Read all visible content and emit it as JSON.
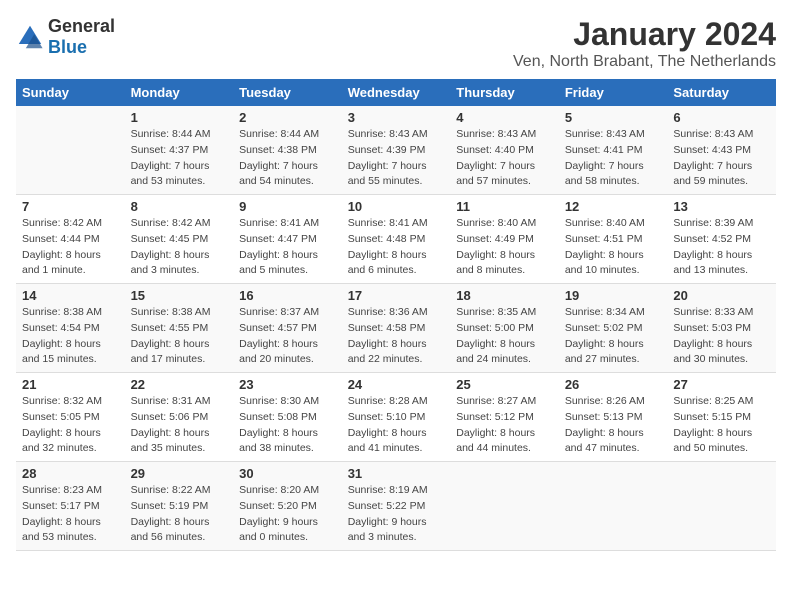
{
  "logo": {
    "text_general": "General",
    "text_blue": "Blue"
  },
  "header": {
    "title": "January 2024",
    "subtitle": "Ven, North Brabant, The Netherlands"
  },
  "calendar": {
    "weekdays": [
      "Sunday",
      "Monday",
      "Tuesday",
      "Wednesday",
      "Thursday",
      "Friday",
      "Saturday"
    ],
    "weeks": [
      [
        {
          "day": "",
          "sunrise": "",
          "sunset": "",
          "daylight": ""
        },
        {
          "day": "1",
          "sunrise": "Sunrise: 8:44 AM",
          "sunset": "Sunset: 4:37 PM",
          "daylight": "Daylight: 7 hours and 53 minutes."
        },
        {
          "day": "2",
          "sunrise": "Sunrise: 8:44 AM",
          "sunset": "Sunset: 4:38 PM",
          "daylight": "Daylight: 7 hours and 54 minutes."
        },
        {
          "day": "3",
          "sunrise": "Sunrise: 8:43 AM",
          "sunset": "Sunset: 4:39 PM",
          "daylight": "Daylight: 7 hours and 55 minutes."
        },
        {
          "day": "4",
          "sunrise": "Sunrise: 8:43 AM",
          "sunset": "Sunset: 4:40 PM",
          "daylight": "Daylight: 7 hours and 57 minutes."
        },
        {
          "day": "5",
          "sunrise": "Sunrise: 8:43 AM",
          "sunset": "Sunset: 4:41 PM",
          "daylight": "Daylight: 7 hours and 58 minutes."
        },
        {
          "day": "6",
          "sunrise": "Sunrise: 8:43 AM",
          "sunset": "Sunset: 4:43 PM",
          "daylight": "Daylight: 7 hours and 59 minutes."
        }
      ],
      [
        {
          "day": "7",
          "sunrise": "Sunrise: 8:42 AM",
          "sunset": "Sunset: 4:44 PM",
          "daylight": "Daylight: 8 hours and 1 minute."
        },
        {
          "day": "8",
          "sunrise": "Sunrise: 8:42 AM",
          "sunset": "Sunset: 4:45 PM",
          "daylight": "Daylight: 8 hours and 3 minutes."
        },
        {
          "day": "9",
          "sunrise": "Sunrise: 8:41 AM",
          "sunset": "Sunset: 4:47 PM",
          "daylight": "Daylight: 8 hours and 5 minutes."
        },
        {
          "day": "10",
          "sunrise": "Sunrise: 8:41 AM",
          "sunset": "Sunset: 4:48 PM",
          "daylight": "Daylight: 8 hours and 6 minutes."
        },
        {
          "day": "11",
          "sunrise": "Sunrise: 8:40 AM",
          "sunset": "Sunset: 4:49 PM",
          "daylight": "Daylight: 8 hours and 8 minutes."
        },
        {
          "day": "12",
          "sunrise": "Sunrise: 8:40 AM",
          "sunset": "Sunset: 4:51 PM",
          "daylight": "Daylight: 8 hours and 10 minutes."
        },
        {
          "day": "13",
          "sunrise": "Sunrise: 8:39 AM",
          "sunset": "Sunset: 4:52 PM",
          "daylight": "Daylight: 8 hours and 13 minutes."
        }
      ],
      [
        {
          "day": "14",
          "sunrise": "Sunrise: 8:38 AM",
          "sunset": "Sunset: 4:54 PM",
          "daylight": "Daylight: 8 hours and 15 minutes."
        },
        {
          "day": "15",
          "sunrise": "Sunrise: 8:38 AM",
          "sunset": "Sunset: 4:55 PM",
          "daylight": "Daylight: 8 hours and 17 minutes."
        },
        {
          "day": "16",
          "sunrise": "Sunrise: 8:37 AM",
          "sunset": "Sunset: 4:57 PM",
          "daylight": "Daylight: 8 hours and 20 minutes."
        },
        {
          "day": "17",
          "sunrise": "Sunrise: 8:36 AM",
          "sunset": "Sunset: 4:58 PM",
          "daylight": "Daylight: 8 hours and 22 minutes."
        },
        {
          "day": "18",
          "sunrise": "Sunrise: 8:35 AM",
          "sunset": "Sunset: 5:00 PM",
          "daylight": "Daylight: 8 hours and 24 minutes."
        },
        {
          "day": "19",
          "sunrise": "Sunrise: 8:34 AM",
          "sunset": "Sunset: 5:02 PM",
          "daylight": "Daylight: 8 hours and 27 minutes."
        },
        {
          "day": "20",
          "sunrise": "Sunrise: 8:33 AM",
          "sunset": "Sunset: 5:03 PM",
          "daylight": "Daylight: 8 hours and 30 minutes."
        }
      ],
      [
        {
          "day": "21",
          "sunrise": "Sunrise: 8:32 AM",
          "sunset": "Sunset: 5:05 PM",
          "daylight": "Daylight: 8 hours and 32 minutes."
        },
        {
          "day": "22",
          "sunrise": "Sunrise: 8:31 AM",
          "sunset": "Sunset: 5:06 PM",
          "daylight": "Daylight: 8 hours and 35 minutes."
        },
        {
          "day": "23",
          "sunrise": "Sunrise: 8:30 AM",
          "sunset": "Sunset: 5:08 PM",
          "daylight": "Daylight: 8 hours and 38 minutes."
        },
        {
          "day": "24",
          "sunrise": "Sunrise: 8:28 AM",
          "sunset": "Sunset: 5:10 PM",
          "daylight": "Daylight: 8 hours and 41 minutes."
        },
        {
          "day": "25",
          "sunrise": "Sunrise: 8:27 AM",
          "sunset": "Sunset: 5:12 PM",
          "daylight": "Daylight: 8 hours and 44 minutes."
        },
        {
          "day": "26",
          "sunrise": "Sunrise: 8:26 AM",
          "sunset": "Sunset: 5:13 PM",
          "daylight": "Daylight: 8 hours and 47 minutes."
        },
        {
          "day": "27",
          "sunrise": "Sunrise: 8:25 AM",
          "sunset": "Sunset: 5:15 PM",
          "daylight": "Daylight: 8 hours and 50 minutes."
        }
      ],
      [
        {
          "day": "28",
          "sunrise": "Sunrise: 8:23 AM",
          "sunset": "Sunset: 5:17 PM",
          "daylight": "Daylight: 8 hours and 53 minutes."
        },
        {
          "day": "29",
          "sunrise": "Sunrise: 8:22 AM",
          "sunset": "Sunset: 5:19 PM",
          "daylight": "Daylight: 8 hours and 56 minutes."
        },
        {
          "day": "30",
          "sunrise": "Sunrise: 8:20 AM",
          "sunset": "Sunset: 5:20 PM",
          "daylight": "Daylight: 9 hours and 0 minutes."
        },
        {
          "day": "31",
          "sunrise": "Sunrise: 8:19 AM",
          "sunset": "Sunset: 5:22 PM",
          "daylight": "Daylight: 9 hours and 3 minutes."
        },
        {
          "day": "",
          "sunrise": "",
          "sunset": "",
          "daylight": ""
        },
        {
          "day": "",
          "sunrise": "",
          "sunset": "",
          "daylight": ""
        },
        {
          "day": "",
          "sunrise": "",
          "sunset": "",
          "daylight": ""
        }
      ]
    ]
  }
}
